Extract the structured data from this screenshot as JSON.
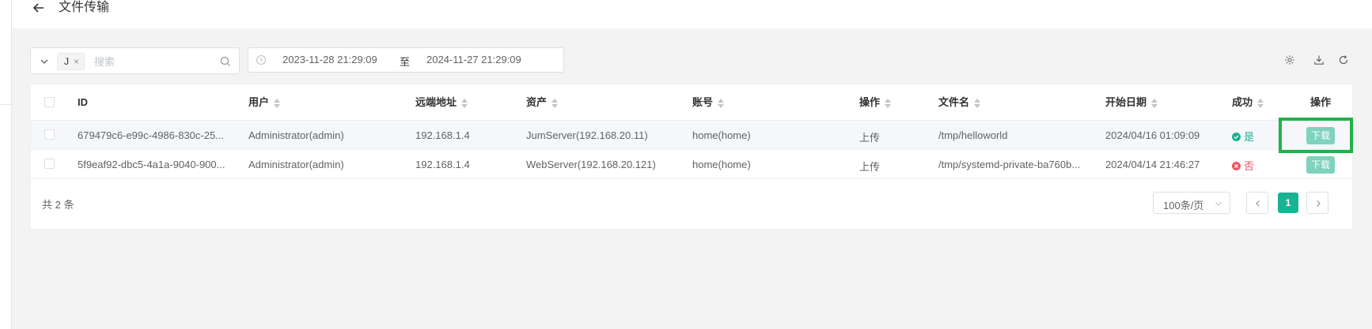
{
  "header": {
    "back_icon": "arrow-left-icon",
    "title": "文件传输"
  },
  "filter": {
    "tag_label": "J",
    "tag_close": "×",
    "search_placeholder": "搜索",
    "date_start": "2023-11-28 21:29:09",
    "date_separator": "至",
    "date_end": "2024-11-27 21:29:09"
  },
  "toolbar_icons": [
    "gear-icon",
    "download-icon",
    "refresh-icon"
  ],
  "table": {
    "columns": {
      "id": "ID",
      "user": "用户",
      "remote_addr": "远端地址",
      "asset": "资产",
      "account": "账号",
      "operate": "操作",
      "filename": "文件名",
      "date_start": "开始日期",
      "success": "成功",
      "actions": "操作"
    },
    "rows": [
      {
        "id": "679479c6-e99c-4986-830c-25...",
        "user": "Administrator(admin)",
        "remote_addr": "192.168.1.4",
        "asset": "JumServer(192.168.20.11)",
        "account": "home(home)",
        "operate": "上传",
        "filename": "/tmp/helloworld",
        "date_start": "2024/04/16 01:09:09",
        "success": "是",
        "action_label": "下载"
      },
      {
        "id": "5f9eaf92-dbc5-4a1a-9040-900...",
        "user": "Administrator(admin)",
        "remote_addr": "192.168.1.4",
        "asset": "WebServer(192.168.20.121)",
        "account": "home(home)",
        "operate": "上传",
        "filename": "/tmp/systemd-private-ba760b...",
        "date_start": "2024/04/14 21:46:27",
        "success": "否",
        "action_label": "下载"
      }
    ]
  },
  "pagination": {
    "total": "共 2 条",
    "page_size": "100条/页",
    "current_page": "1"
  },
  "colors": {
    "accent": "#1ab394",
    "success": "#1ab394",
    "fail": "#ed5565",
    "highlight": "#22b14c"
  }
}
